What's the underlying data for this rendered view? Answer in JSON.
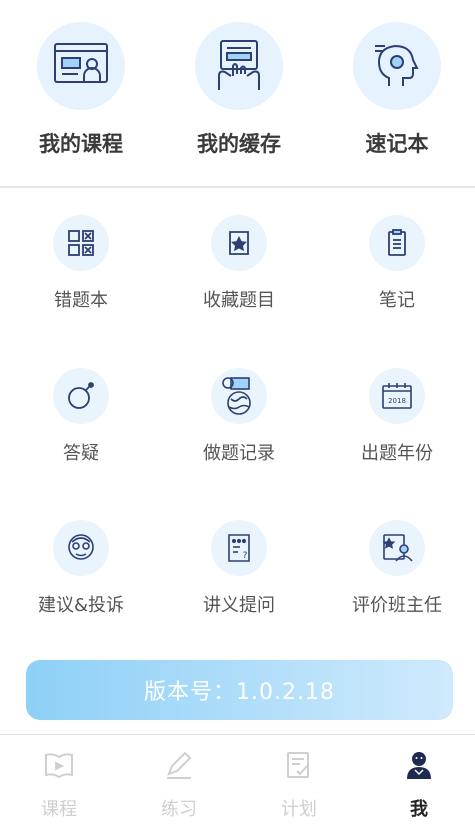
{
  "top": [
    {
      "label": "我的课程",
      "icon": "course-screen-icon"
    },
    {
      "label": "我的缓存",
      "icon": "cache-download-icon"
    },
    {
      "label": "速记本",
      "icon": "memory-head-icon"
    }
  ],
  "grid": [
    {
      "label": "错题本",
      "icon": "wrong-questions-icon"
    },
    {
      "label": "收藏题目",
      "icon": "favorite-star-icon"
    },
    {
      "label": "笔记",
      "icon": "notes-clipboard-icon"
    },
    {
      "label": "答疑",
      "icon": "qa-bomb-icon"
    },
    {
      "label": "做题记录",
      "icon": "practice-record-icon"
    },
    {
      "label": "出题年份",
      "icon": "calendar-year-icon",
      "calendar_text": "2018"
    },
    {
      "label": "建议&投诉",
      "icon": "suggestion-face-icon"
    },
    {
      "label": "讲义提问",
      "icon": "handout-question-icon"
    },
    {
      "label": "评价班主任",
      "icon": "rate-teacher-icon"
    }
  ],
  "version": "版本号：1.0.2.18",
  "tabs": [
    {
      "label": "课程",
      "icon": "book-play-icon",
      "active": false
    },
    {
      "label": "练习",
      "icon": "pencil-icon",
      "active": false
    },
    {
      "label": "计划",
      "icon": "checklist-icon",
      "active": false
    },
    {
      "label": "我",
      "icon": "user-icon",
      "active": true
    }
  ],
  "colors": {
    "accent_light": "#e6f2fd",
    "icon_stroke": "#2d3f73",
    "inactive_tab": "#cfcfcf"
  }
}
